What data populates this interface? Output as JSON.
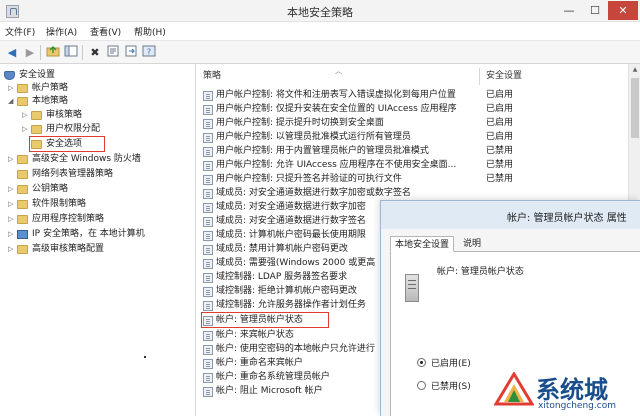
{
  "window": {
    "title": "本地安全策略",
    "controls": {
      "minimize": "—",
      "maximize": "☐",
      "close": "✕"
    }
  },
  "menu": [
    "文件(F)",
    "操作(A)",
    "查看(V)",
    "帮助(H)"
  ],
  "toolbar": {
    "icons": [
      "back-icon",
      "forward-icon",
      "up-folder-icon",
      "show-hide-tree-icon",
      "delete-icon",
      "properties-icon",
      "help-icon",
      "export-icon"
    ]
  },
  "tree": {
    "root": "安全设置",
    "items": [
      {
        "label": "帐户策略",
        "level": 1,
        "expanded": false
      },
      {
        "label": "本地策略",
        "level": 1,
        "expanded": true
      },
      {
        "label": "审核策略",
        "level": 2,
        "expanded": false
      },
      {
        "label": "用户权限分配",
        "level": 2,
        "expanded": false
      },
      {
        "label": "安全选项",
        "level": 2,
        "selected": true
      },
      {
        "label": "高级安全 Windows 防火墙",
        "level": 1
      },
      {
        "label": "网络列表管理器策略",
        "level": 1
      },
      {
        "label": "公钥策略",
        "level": 1
      },
      {
        "label": "软件限制策略",
        "level": 1
      },
      {
        "label": "应用程序控制策略",
        "level": 1
      },
      {
        "label": "IP 安全策略，在 本地计算机",
        "level": 1
      },
      {
        "label": "高级审核策略配置",
        "level": 1
      }
    ]
  },
  "list": {
    "columns": {
      "policy": "策略",
      "setting": "安全设置"
    },
    "rows": [
      {
        "name": "用户帐户控制: 将文件和注册表写入错误虚拟化到每用户位置",
        "setting": "已启用"
      },
      {
        "name": "用户帐户控制: 仅提升安装在安全位置的 UIAccess 应用程序",
        "setting": "已启用"
      },
      {
        "name": "用户帐户控制: 提示提升时切换到安全桌面",
        "setting": "已启用"
      },
      {
        "name": "用户帐户控制: 以管理员批准模式运行所有管理员",
        "setting": "已启用"
      },
      {
        "name": "用户帐户控制: 用于内置管理员帐户的管理员批准模式",
        "setting": "已禁用"
      },
      {
        "name": "用户帐户控制: 允许 UIAccess 应用程序在不使用安全桌面...",
        "setting": "已禁用"
      },
      {
        "name": "用户帐户控制: 只提升签名并验证的可执行文件",
        "setting": "已禁用"
      },
      {
        "name": "域成员: 对安全通道数据进行数字加密或数字签名",
        "setting": ""
      },
      {
        "name": "域成员: 对安全通道数据进行数字加密",
        "setting": ""
      },
      {
        "name": "域成员: 对安全通道数据进行数字签名",
        "setting": ""
      },
      {
        "name": "域成员: 计算机帐户密码最长使用期限",
        "setting": ""
      },
      {
        "name": "域成员: 禁用计算机帐户密码更改",
        "setting": ""
      },
      {
        "name": "域成员: 需要强(Windows 2000 或更高",
        "setting": ""
      },
      {
        "name": "域控制器: LDAP 服务器签名要求",
        "setting": ""
      },
      {
        "name": "域控制器: 拒绝计算机帐户密码更改",
        "setting": ""
      },
      {
        "name": "域控制器: 允许服务器操作者计划任务",
        "setting": ""
      },
      {
        "name": "帐户: 管理员帐户状态",
        "setting": "",
        "highlighted": true
      },
      {
        "name": "帐户: 来宾帐户状态",
        "setting": ""
      },
      {
        "name": "帐户: 使用空密码的本地帐户只允许进行",
        "setting": ""
      },
      {
        "name": "帐户: 重命名来宾帐户",
        "setting": ""
      },
      {
        "name": "帐户: 重命名系统管理员帐户",
        "setting": ""
      },
      {
        "name": "帐户: 阻止 Microsoft 帐户",
        "setting": ""
      }
    ]
  },
  "dialog": {
    "title": "帐户: 管理员帐户状态 属性",
    "tabs": [
      "本地安全设置",
      "说明"
    ],
    "policy_name": "帐户: 管理员帐户状态",
    "options": [
      {
        "label": "已启用(E)",
        "checked": true
      },
      {
        "label": "已禁用(S)",
        "checked": false
      }
    ]
  },
  "watermark": {
    "text": "系统城",
    "url": "xitongcheng.com"
  },
  "colors": {
    "highlight_border": "#e03c31",
    "close_button": "#c7463b",
    "watermark": "#1a4d8c"
  }
}
